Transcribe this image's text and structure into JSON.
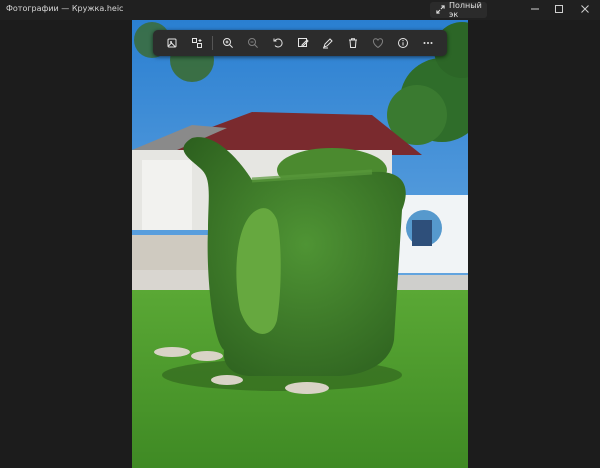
{
  "window": {
    "title": "Фотографии — Кружка.heic",
    "fullscreen_label": "Полный эк"
  },
  "toolbar": {
    "buttons": [
      "crop-rotate-icon",
      "edit-image-icon",
      "zoom-in-icon",
      "zoom-out-icon",
      "rotate-icon",
      "draw-icon",
      "edit-icon",
      "delete-icon",
      "favorite-icon",
      "info-icon",
      "more-icon"
    ]
  },
  "colors": {
    "background": "#1f1f1f",
    "toolbar": "#2c2c2c",
    "sky": "#2f86d6",
    "grass": "#4fa02c",
    "topiary": "#3e7f2a",
    "roof": "#7a2a2e"
  }
}
